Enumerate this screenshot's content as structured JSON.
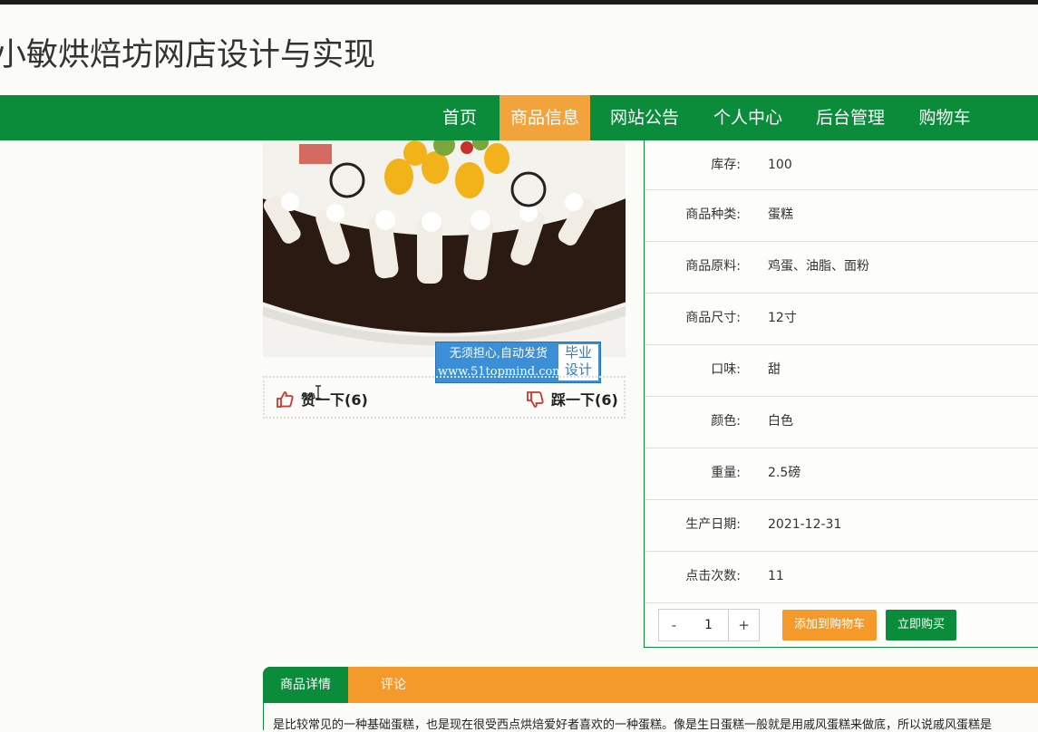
{
  "site": {
    "title": "小敏烘焙坊网店设计与实现"
  },
  "nav": {
    "items": [
      {
        "label": "首页",
        "active": false
      },
      {
        "label": "商品信息",
        "active": true
      },
      {
        "label": "网站公告",
        "active": false
      },
      {
        "label": "个人中心",
        "active": false
      },
      {
        "label": "后台管理",
        "active": false
      },
      {
        "label": "购物车",
        "active": false
      }
    ]
  },
  "watermark": {
    "line1": "无须担心,自动发货",
    "line2": "www.51topmind.com",
    "side1": "毕业",
    "side2": "设计"
  },
  "votes": {
    "like": "赞一下(6)",
    "dislike": "踩一下(6)"
  },
  "details": [
    {
      "label": "库存:",
      "value": "100"
    },
    {
      "label": "商品种类:",
      "value": "蛋糕"
    },
    {
      "label": "商品原料:",
      "value": "鸡蛋、油脂、面粉"
    },
    {
      "label": "商品尺寸:",
      "value": "12寸"
    },
    {
      "label": "口味:",
      "value": "甜"
    },
    {
      "label": "颜色:",
      "value": "白色"
    },
    {
      "label": "重量:",
      "value": "2.5磅"
    },
    {
      "label": "生产日期:",
      "value": "2021-12-31"
    },
    {
      "label": "点击次数:",
      "value": "11"
    }
  ],
  "quantity": {
    "minus": "-",
    "value": "1",
    "plus": "+"
  },
  "actions": {
    "add_cart": "添加到购物车",
    "buy_now": "立即购买"
  },
  "tabs": [
    {
      "label": "商品详情",
      "active": true
    },
    {
      "label": "评论",
      "active": false
    }
  ],
  "description": "是比较常见的一种基础蛋糕，也是现在很受西点烘焙爱好者喜欢的一种蛋糕。像是生日蛋糕一般就是用戚风蛋糕来做底，所以说戚风蛋糕是",
  "colors": {
    "primary": "#0a8c3a",
    "accent": "#f3a33b"
  }
}
